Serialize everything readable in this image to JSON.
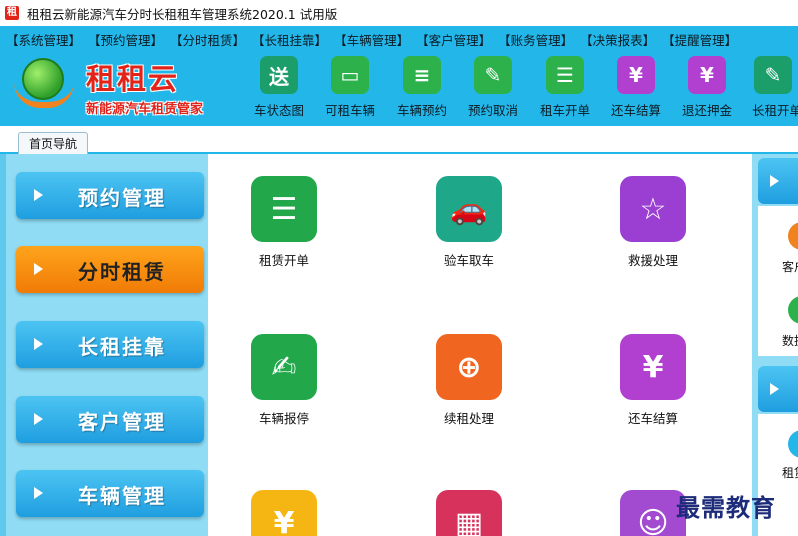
{
  "window": {
    "logo_char": "租",
    "title": "租租云新能源汽车分时长租租车管理系统2020.1 试用版"
  },
  "menu": [
    "【系统管理】",
    "【预约管理】",
    "【分时租赁】",
    "【长租挂靠】",
    "【车辆管理】",
    "【客户管理】",
    "【账务管理】",
    "【决策报表】",
    "【提醒管理】"
  ],
  "brand": {
    "name": "租租云",
    "slogan": "新能源汽车租赁管家",
    "colors": {
      "name": "#e2231a",
      "globe": "#2e9f2a",
      "hand": "#f0821f"
    }
  },
  "toolbar": [
    {
      "label": "车状态图",
      "icon": "delivery-truck-icon",
      "glyph": "送",
      "color": "#1c9e6b"
    },
    {
      "label": "可租车辆",
      "icon": "folder-icon",
      "glyph": "▭",
      "color": "#2db24b"
    },
    {
      "label": "车辆预约",
      "icon": "document-icon",
      "glyph": "≡",
      "color": "#2db24b"
    },
    {
      "label": "预约取消",
      "icon": "edit-icon",
      "glyph": "✎",
      "color": "#2db24b"
    },
    {
      "label": "租车开单",
      "icon": "cart-list-icon",
      "glyph": "☰",
      "color": "#2db24b"
    },
    {
      "label": "还车结算",
      "icon": "yen-receipt-icon",
      "glyph": "¥",
      "color": "#b13fd0"
    },
    {
      "label": "退还押金",
      "icon": "yen-return-icon",
      "glyph": "¥",
      "color": "#b13fd0"
    },
    {
      "label": "长租开单",
      "icon": "note-icon",
      "glyph": "✎",
      "color": "#1c9e6b"
    }
  ],
  "tabs": [
    {
      "label": "首页导航"
    }
  ],
  "left_nav": [
    {
      "label": "预约管理",
      "active": false
    },
    {
      "label": "分时租赁",
      "active": true
    },
    {
      "label": "长租挂靠",
      "active": false
    },
    {
      "label": "客户管理",
      "active": false
    },
    {
      "label": "车辆管理",
      "active": false
    }
  ],
  "tiles": [
    {
      "label": "租赁开单",
      "icon": "cart-list-icon",
      "glyph": "☰",
      "color": "#22a84a"
    },
    {
      "label": "验车取车",
      "icon": "car-check-icon",
      "glyph": "🚗",
      "color": "#1ea889"
    },
    {
      "label": "救援处理",
      "icon": "star-icon",
      "glyph": "☆",
      "color": "#9a3fd1"
    },
    {
      "label": "车辆报停",
      "icon": "edit-pen-icon",
      "glyph": "✍",
      "color": "#22a84a"
    },
    {
      "label": "续租处理",
      "icon": "renew-icon",
      "glyph": "⊕",
      "color": "#f0651f"
    },
    {
      "label": "还车结算",
      "icon": "yen-receipt-icon",
      "glyph": "¥",
      "color": "#b13fd0"
    },
    {
      "label": "",
      "icon": "yen-coin-icon",
      "glyph": "¥",
      "color": "#f5b614"
    },
    {
      "label": "",
      "icon": "calculator-icon",
      "glyph": "▦",
      "color": "#d7325c"
    },
    {
      "label": "",
      "icon": "chat-user-icon",
      "glyph": "☺",
      "color": "#a24bd1"
    }
  ],
  "right_panel": {
    "items": [
      {
        "label": "客户",
        "icon": "customer-icon",
        "color": "#f0821f"
      },
      {
        "label": "数据",
        "icon": "data-icon",
        "color": "#2db24b"
      },
      {
        "label": "租赁",
        "icon": "lease-icon",
        "color": "#23b7e9"
      }
    ]
  },
  "watermark": "最需教育"
}
